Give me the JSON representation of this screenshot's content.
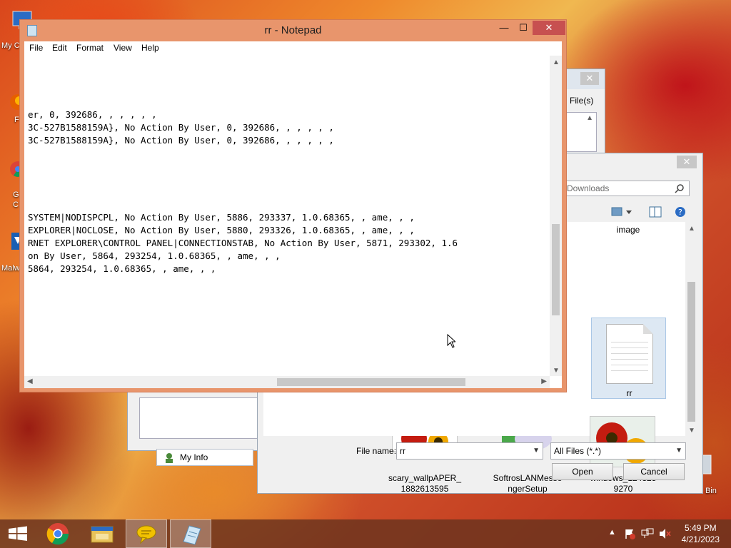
{
  "desktop": {
    "icons": [
      {
        "label": "My C",
        "icon": "computer-icon"
      },
      {
        "label": "F",
        "icon": "firefox-icon"
      },
      {
        "label": "G\nC",
        "icon": "chrome-icon"
      },
      {
        "label": "Malw",
        "icon": "malwarebytes-icon"
      }
    ],
    "recycle_label": "Bin"
  },
  "bg_dialog": {
    "close": "✕",
    "files_label": "l File(s)",
    "my_info": "My Info"
  },
  "open_dialog": {
    "close": "✕",
    "search_placeholder": "ch Downloads",
    "files": [
      {
        "name": "image",
        "kind": "folder-label"
      },
      {
        "name": "rr",
        "kind": "text-file",
        "selected": true
      },
      {
        "name": "scary_wallpAPER_\n1882613595",
        "kind": "image"
      },
      {
        "name": "SoftrosLANMesse\nngerSetup",
        "kind": "installer"
      },
      {
        "name": "windows_124325\n9270",
        "kind": "image"
      }
    ],
    "file_name_label": "File name:",
    "file_name_value": "rr",
    "file_type_value": "All Files (*.*)",
    "open_button": "Open",
    "cancel_button": "Cancel"
  },
  "notepad": {
    "title": "rr - Notepad",
    "buttons": {
      "minimize": "—",
      "maximize": "☐",
      "close": "✕"
    },
    "menu": [
      "File",
      "Edit",
      "Format",
      "View",
      "Help"
    ],
    "lines": [
      "er, 0, 392686, , , , , ,",
      "3C-527B1588159A}, No Action By User, 0, 392686, , , , , ,",
      "3C-527B1588159A}, No Action By User, 0, 392686, , , , , ,",
      "SYSTEM|NODISPCPL, No Action By User, 5886, 293337, 1.0.68365, , ame, , ,",
      "EXPLORER|NOCLOSE, No Action By User, 5880, 293326, 1.0.68365, , ame, , ,",
      "RNET EXPLORER\\CONTROL PANEL|CONNECTIONSTAB, No Action By User, 5871, 293302, 1.6",
      "on By User, 5864, 293254, 1.0.68365, , ame, , ,",
      "5864, 293254, 1.0.68365, , ame, , ,"
    ]
  },
  "taskbar": {
    "apps": [
      "start-icon",
      "chrome-icon",
      "file-explorer-icon",
      "chat-icon",
      "notepad-icon"
    ],
    "time": "5:49 PM",
    "date": "4/21/2023"
  },
  "colors": {
    "notepad_frame": "#e8956c",
    "close_red": "#c75050",
    "taskbar": "#6e341e"
  }
}
